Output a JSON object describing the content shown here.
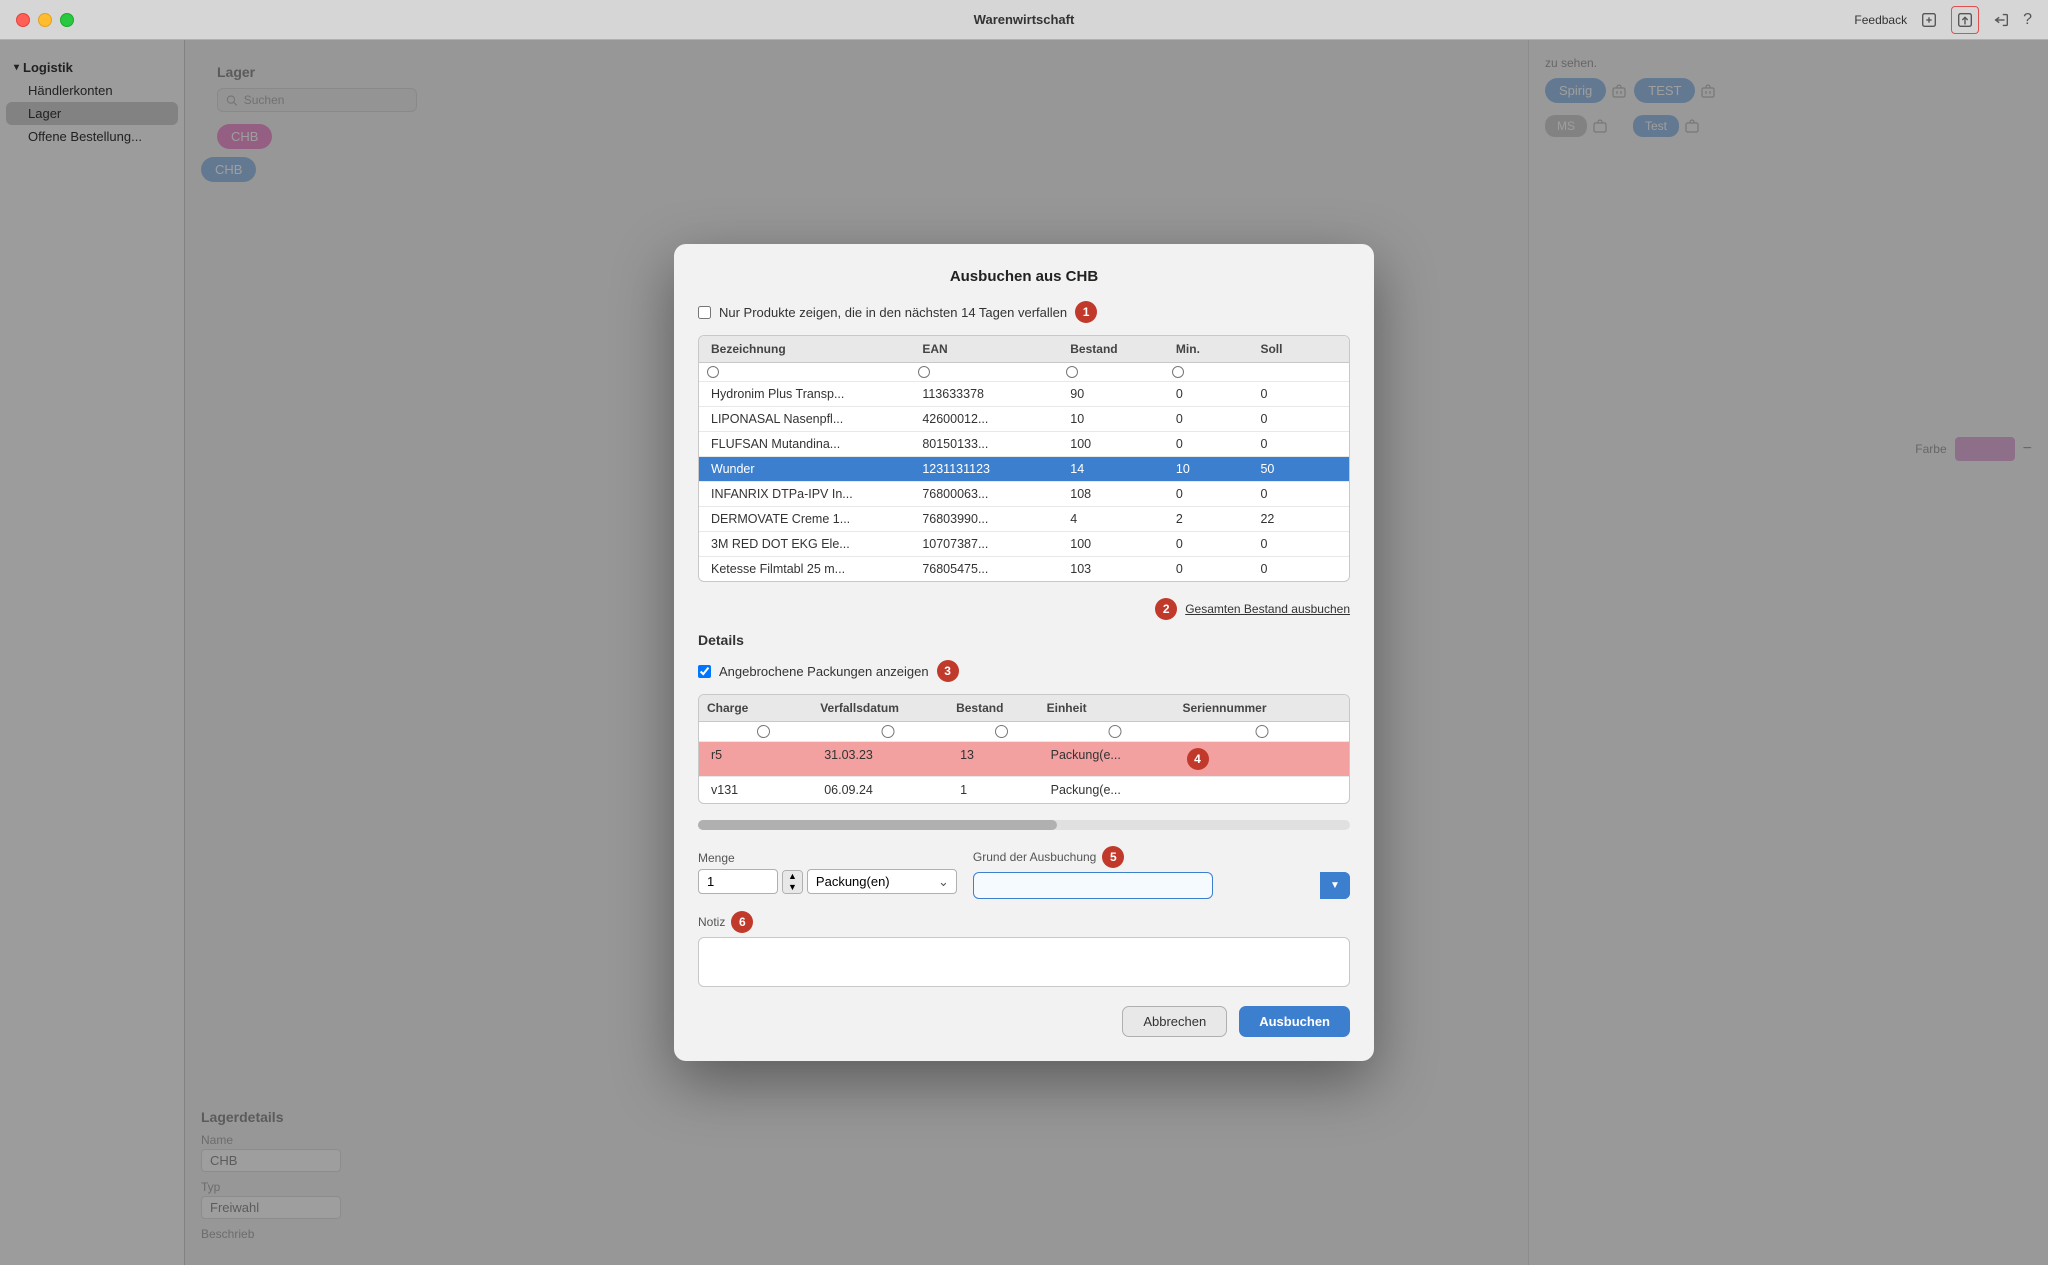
{
  "app": {
    "title": "Warenwirtschaft",
    "feedback_label": "Feedback"
  },
  "sidebar": {
    "group_label": "Logistik",
    "items": [
      {
        "id": "händlerkonten",
        "label": "Händlerkonten"
      },
      {
        "id": "lager",
        "label": "Lager"
      },
      {
        "id": "offene_bestellung",
        "label": "Offene Bestellung..."
      }
    ]
  },
  "lager": {
    "section_title": "Lager",
    "search_placeholder": "Suchen",
    "tabs": [
      {
        "id": "chb1",
        "label": "CHB",
        "style": "pink"
      },
      {
        "id": "chb2",
        "label": "CHB",
        "style": "blue"
      }
    ],
    "right_tabs": [
      {
        "id": "spirig",
        "label": "Spirig"
      },
      {
        "id": "test",
        "label": "TEST"
      }
    ],
    "ms_label": "MS",
    "test_label": "Test"
  },
  "lagerdetails": {
    "section_title": "Lagerdetails",
    "name_label": "Name",
    "name_value": "CHB",
    "typ_label": "Typ",
    "typ_value": "Freiwahl",
    "beschrieb_label": "Beschrieb",
    "farbe_label": "Farbe"
  },
  "modal": {
    "title": "Ausbuchen aus CHB",
    "filter_checkbox_label": "Nur Produkte zeigen, die in den nächsten 14 Tagen verfallen",
    "filter_checked": false,
    "product_table": {
      "columns": [
        "Bezeichnung",
        "EAN",
        "Bestand",
        "Min.",
        "Soll"
      ],
      "rows": [
        {
          "bezeichnung": "Hydronim Plus Transp...",
          "ean": "113633378",
          "bestand": "90",
          "min": "0",
          "soll": "0",
          "selected": false
        },
        {
          "bezeichnung": "LIPONASAL Nasenpfl...",
          "ean": "42600012...",
          "bestand": "10",
          "min": "0",
          "soll": "0",
          "selected": false
        },
        {
          "bezeichnung": "FLUFSAN Mutandina...",
          "ean": "80150133...",
          "bestand": "100",
          "min": "0",
          "soll": "0",
          "selected": false
        },
        {
          "bezeichnung": "Wunder",
          "ean": "1231131123",
          "bestand": "14",
          "min": "10",
          "soll": "50",
          "selected": true
        },
        {
          "bezeichnung": "INFANRIX DTPa-IPV In...",
          "ean": "76800063...",
          "bestand": "108",
          "min": "0",
          "soll": "0",
          "selected": false
        },
        {
          "bezeichnung": "DERMOVATE Creme 1...",
          "ean": "76803990...",
          "bestand": "4",
          "min": "2",
          "soll": "22",
          "selected": false
        },
        {
          "bezeichnung": "3M RED DOT EKG Ele...",
          "ean": "10707387...",
          "bestand": "100",
          "min": "0",
          "soll": "0",
          "selected": false
        },
        {
          "bezeichnung": "Ketesse Filmtabl 25 m...",
          "ean": "76805475...",
          "bestand": "103",
          "min": "0",
          "soll": "0",
          "selected": false
        }
      ]
    },
    "gesamten_btn_label": "Gesamten Bestand ausbuchen",
    "details_title": "Details",
    "angebrochene_label": "Angebrochene Packungen anzeigen",
    "angebrochene_checked": true,
    "batch_table": {
      "columns": [
        "Charge",
        "Verfallsdatum",
        "Bestand",
        "Einheit",
        "Seriennummer"
      ],
      "rows": [
        {
          "charge": "r5",
          "verfallsdatum": "31.03.23",
          "bestand": "13",
          "einheit": "Packung(e...",
          "seriennummer": "",
          "selected": true
        },
        {
          "charge": "v131",
          "verfallsdatum": "06.09.24",
          "bestand": "1",
          "einheit": "Packung(e...",
          "seriennummer": "",
          "selected": false
        }
      ]
    },
    "menge_label": "Menge",
    "menge_value": "1",
    "einheit_label": "Packung(en)",
    "grund_label": "Grund der Ausbuchung",
    "grund_value": "",
    "notiz_label": "Notiz",
    "notiz_placeholder": "",
    "cancel_btn": "Abbrechen",
    "confirm_btn": "Ausbuchen"
  },
  "step_badges": [
    "1",
    "2",
    "3",
    "4",
    "5",
    "6"
  ],
  "info_text": "zu sehen."
}
